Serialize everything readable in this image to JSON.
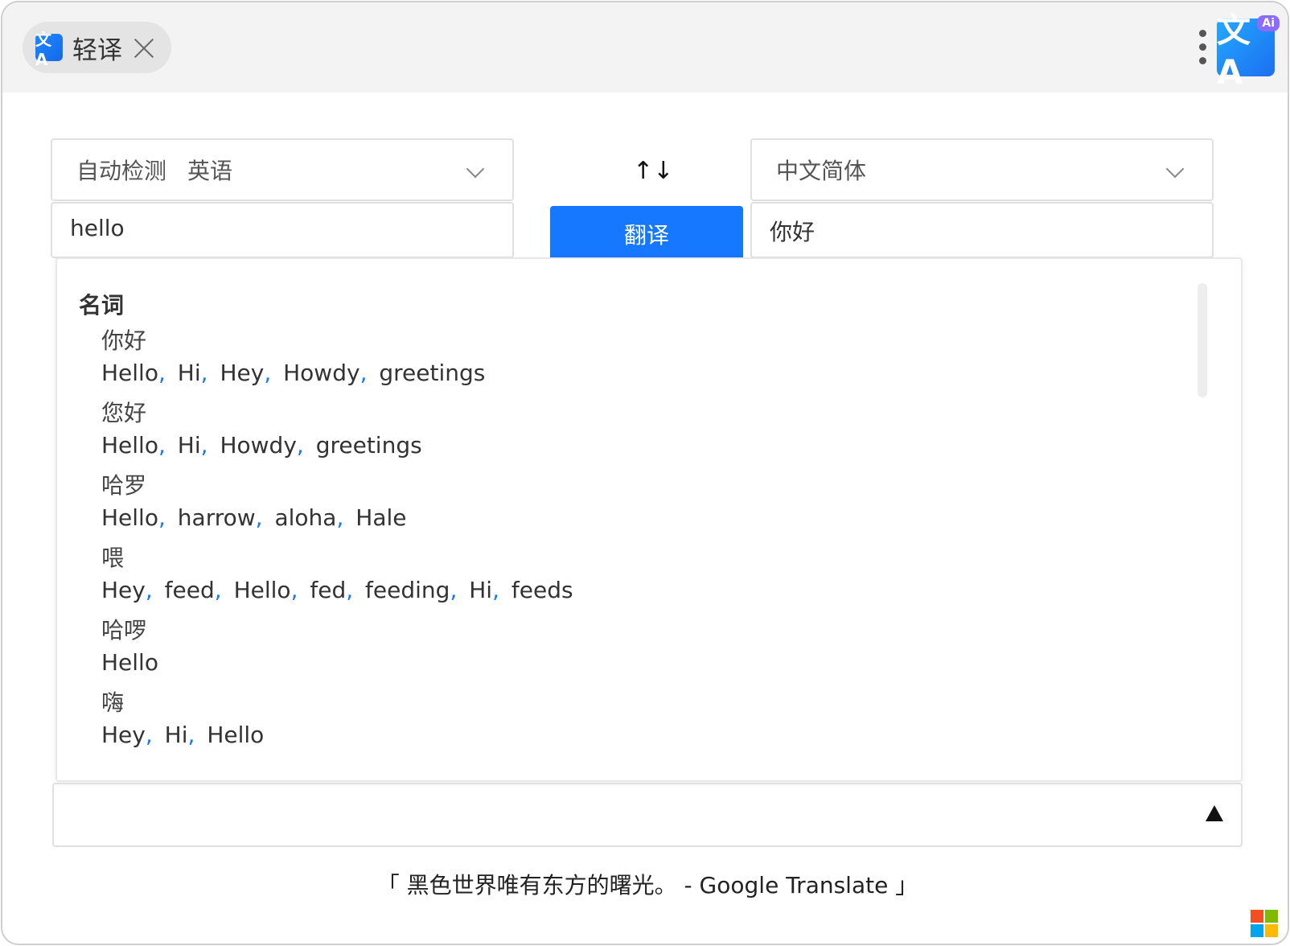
{
  "tab": {
    "icon": "文A",
    "title": "轻译"
  },
  "header": {
    "logo": "文A",
    "ai_badge": "Ai"
  },
  "source": {
    "auto_label": "自动检测",
    "detected": "英语",
    "text": "hello"
  },
  "target": {
    "language": "中文简体",
    "text": "你好"
  },
  "actions": {
    "swap": "↑↓",
    "translate": "翻译"
  },
  "dictionary": {
    "part_of_speech": "名词",
    "entries": [
      {
        "word": "你好",
        "translations": [
          "Hello",
          "Hi",
          "Hey",
          "Howdy",
          "greetings"
        ]
      },
      {
        "word": "您好",
        "translations": [
          "Hello",
          "Hi",
          "Howdy",
          "greetings"
        ]
      },
      {
        "word": "哈罗",
        "translations": [
          "Hello",
          "harrow",
          "aloha",
          "Hale"
        ]
      },
      {
        "word": "喂",
        "translations": [
          "Hey",
          "feed",
          "Hello",
          "fed",
          "feeding",
          "Hi",
          "feeds"
        ]
      },
      {
        "word": "哈啰",
        "translations": [
          "Hello"
        ]
      },
      {
        "word": "嗨",
        "translations": [
          "Hey",
          "Hi",
          "Hello"
        ]
      }
    ]
  },
  "footer": {
    "quote": "「 黑色世界唯有东方的曙光。 - Google Translate 」"
  }
}
